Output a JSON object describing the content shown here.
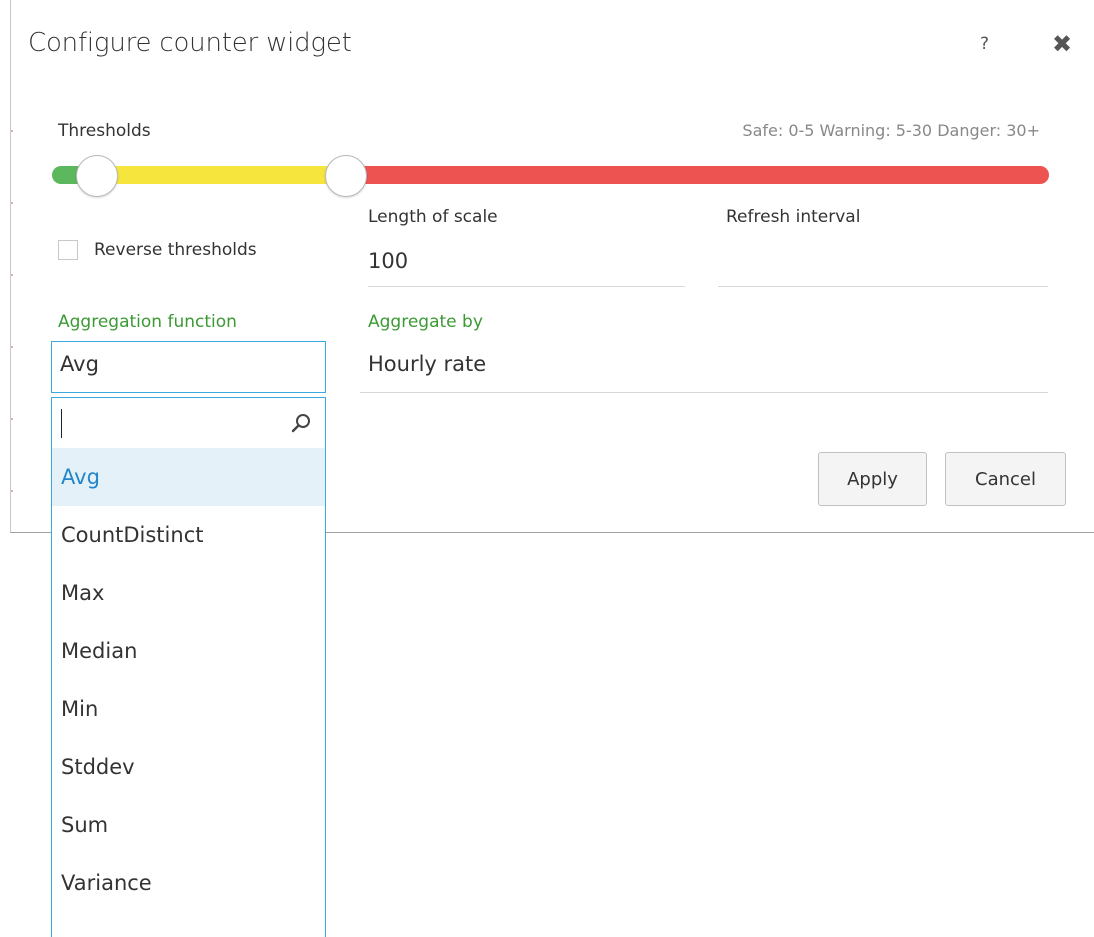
{
  "dialog": {
    "title": "Configure counter widget",
    "help_label": "?",
    "close_label": "✖"
  },
  "thresholds": {
    "label": "Thresholds",
    "summary": "Safe: 0-5 Warning: 5-30 Danger: 30+",
    "safe_max": 5,
    "warning_max": 30,
    "colors": {
      "safe": "#5cb85c",
      "warning": "#f5e53d",
      "danger": "#ed5351"
    }
  },
  "reverse": {
    "label": "Reverse thresholds",
    "checked": false
  },
  "length_of_scale": {
    "label": "Length of scale",
    "value": "100"
  },
  "refresh_interval": {
    "label": "Refresh interval",
    "value": ""
  },
  "aggregation": {
    "label": "Aggregation function",
    "value": "Avg",
    "search_value": "",
    "options": [
      "Avg",
      "CountDistinct",
      "Max",
      "Median",
      "Min",
      "Stddev",
      "Sum",
      "Variance"
    ],
    "selected_index": 0
  },
  "aggregate_by": {
    "label": "Aggregate by",
    "value": "Hourly rate"
  },
  "buttons": {
    "apply": "Apply",
    "cancel": "Cancel"
  },
  "accent_colors": {
    "focus_border": "#3aa7df",
    "label_green": "#3b9a33",
    "selected_bg": "#e4f1f8",
    "selected_text": "#2386c8"
  }
}
